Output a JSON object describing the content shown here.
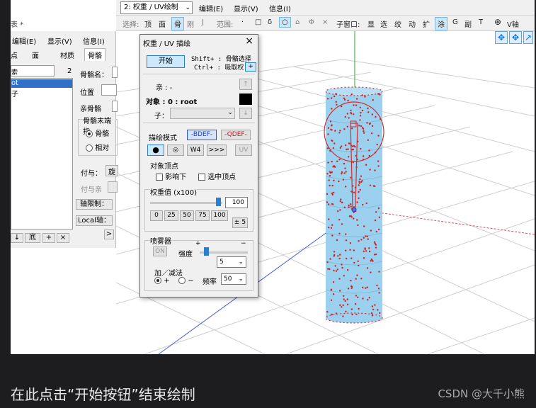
{
  "main": {
    "mode_select": "2: 权重 / UV绘制",
    "menus": [
      "编辑(E)",
      "显示(V)",
      "信息(I)"
    ],
    "toolbar": {
      "select_label": "选择:",
      "select_items": [
        "顶",
        "面",
        "骨",
        "刚",
        "J"
      ],
      "range_label": "范围:",
      "range_items": [
        "·",
        "□",
        "δ",
        "○",
        "⌂",
        "Φ",
        "×"
      ],
      "sub_label": "子窗口:",
      "sub_items": [
        "显",
        "选",
        "绞",
        "动",
        "扩",
        "涂",
        "G",
        "副",
        "T"
      ],
      "axis_label": "V轴"
    }
  },
  "left": {
    "title_fragment": "表 *",
    "menus": [
      "编辑(E)",
      "显示(V)",
      "信息(I)"
    ],
    "tabs": [
      "点",
      "面",
      "材质",
      "骨骼"
    ],
    "search_label": "索",
    "count": "2",
    "list_items": [
      "ot",
      "子"
    ],
    "bone_name_label": "骨骼名：",
    "position_label": "位置",
    "parent_label": "亲骨骼",
    "tail_group_label": "骨骼末端指",
    "tail_options": [
      "骨骼",
      "相对"
    ],
    "assign_label": "付与：",
    "assign_value": "旋",
    "assign_parent_label": "付与亲",
    "axis_limit_button": "轴限制：",
    "local_axis_button": "Local轴：",
    "list_buttons": [
      "↓",
      "底",
      "+",
      "×"
    ],
    "expand_button": ">"
  },
  "dialog": {
    "title": "权重 / UV 描绘",
    "close": "×",
    "start_button": "开始",
    "shift_hint": "Shift+ : 骨骼选择",
    "ctrl_hint": "Ctrl+ : 吸取权",
    "plus_button": "+",
    "parent_label": "亲 : -",
    "target_label": "对象 : 0 : root",
    "child_label": "子：",
    "up_arrow": "↑",
    "down_arrow": "↓",
    "paint_mode_label": "描绘模式",
    "bdef_button": "-BDEF-",
    "qdef_button": "-QDEF-",
    "mode_buttons": [
      "●",
      "◎",
      "W4",
      ">>>",
      "UV"
    ],
    "target_vertex_label": "对象顶点",
    "influence_checkbox": "影响下",
    "selected_checkbox": "选中顶点",
    "weight_label": "权重值 (x100)",
    "weight_value": "100",
    "weight_fraction": 0.93,
    "weight_presets": [
      "0",
      "25",
      "50",
      "75",
      "100"
    ],
    "pm_button": "± 5",
    "spray_label": "喷雾器",
    "on_button": "ON",
    "strength_label": "强度",
    "strength_plus": "+",
    "strength_minus": "−",
    "strength_fraction": 0.1,
    "strength_value": "5",
    "addsub_label": "加／减法",
    "add_option": "+",
    "sub_option": "−",
    "freq_label": "频率",
    "freq_value": "50"
  },
  "caption": "在此点击“开始按钮”结束绘制",
  "watermark": "CSDN @大千小熊"
}
